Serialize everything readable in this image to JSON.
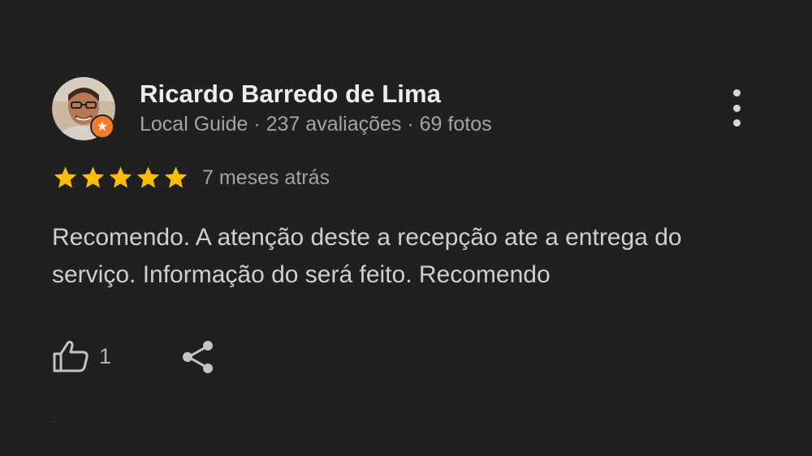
{
  "reviewer": {
    "name": "Ricardo Barredo de Lima",
    "meta": "Local Guide · 237 avaliações · 69 fotos",
    "badge_icon": "local-guide-badge-icon",
    "badge_color": "#f57b2b"
  },
  "rating": {
    "stars": 5,
    "max_stars": 5,
    "star_color": "#fbbc04",
    "time_ago": "7 meses atrás"
  },
  "review": {
    "text": "Recomendo. A atenção deste a recepção ate a entrega do serviço. Informação do será feito. Recomendo"
  },
  "actions": {
    "like_icon": "thumbs-up-icon",
    "like_count": "1",
    "share_icon": "share-icon",
    "more_icon": "more-vert-icon"
  }
}
